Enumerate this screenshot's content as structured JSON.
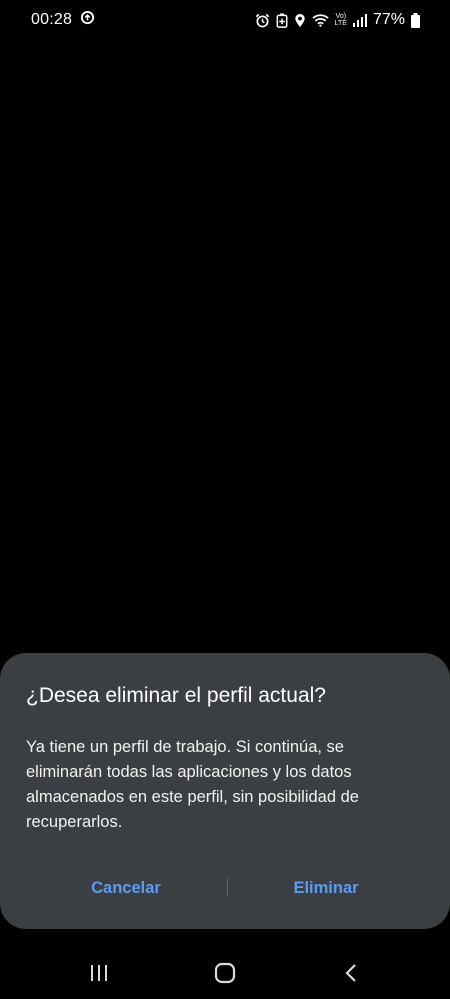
{
  "status_bar": {
    "time": "00:28",
    "battery_percent": "77%",
    "left_icons": [
      "data-saver-icon"
    ],
    "right_icons": [
      "alarm-icon",
      "battery-saver-icon",
      "location-icon",
      "wifi-icon",
      "volte-lte-icon",
      "signal-icon",
      "battery-icon"
    ],
    "network_label_top": "Vo)",
    "network_label_bottom": "LTE"
  },
  "dialog": {
    "title": "¿Desea eliminar el perfil actual?",
    "message": "Ya tiene un perfil de trabajo. Si continúa, se eliminarán todas las aplicaciones y los datos almacenados en este perfil, sin posibilidad de recuperarlos.",
    "cancel_label": "Cancelar",
    "delete_label": "Eliminar"
  },
  "navigation": {
    "buttons": [
      "recents-icon",
      "home-icon",
      "back-icon"
    ]
  },
  "colors": {
    "background": "#000000",
    "dialog_background": "#3b3f43",
    "accent": "#5b9cf3"
  }
}
